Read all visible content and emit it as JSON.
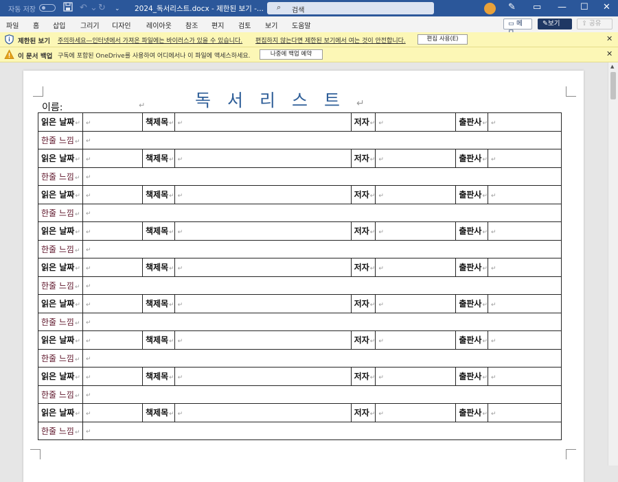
{
  "titlebar": {
    "autosave_label": "자동 저장",
    "autosave_state": "끔",
    "document_title": "2024_독서리스트.docx  -  제한된 보기  -...",
    "search_placeholder": "검색",
    "icons": [
      "save-icon",
      "undo-icon",
      "redo-icon",
      "customize-icon",
      "pen-icon",
      "minimize-icon",
      "restore-icon",
      "close-icon"
    ]
  },
  "ribbon": {
    "tabs": [
      "파일",
      "홈",
      "삽입",
      "그리기",
      "디자인",
      "레이아웃",
      "참조",
      "편지",
      "검토",
      "보기",
      "도움말"
    ],
    "memo_label": "메모",
    "view_label": "보기",
    "share_label": "공유"
  },
  "messages": {
    "protected": {
      "title": "제한된 보기",
      "text1": "주의하세요—인터넷에서 가져온 파일에는 바이러스가 있을 수 있습니다.",
      "text2": "편집하지 않는다면 제한된 보기에서 여는 것이 안전합니다.",
      "button": "편집 사용(E)"
    },
    "backup": {
      "title": "이 문서 백업",
      "text": "구독에 포함된 OneDrive를 사용하여 어디에서나 이 파일에 액세스하세요.",
      "button": "나중에 백업 예약"
    }
  },
  "document": {
    "title": "독서리스트",
    "name_label": "이름:",
    "row_labels": {
      "date": "읽은 날짜",
      "book_title": "책제목",
      "author": "저자",
      "publisher": "출판사",
      "impression": "한줄 느낌"
    },
    "record_count": 9
  },
  "colors": {
    "title_bar": "#2b579a",
    "doc_title": "#2e5e98",
    "message_bar": "#fcf7b6"
  }
}
